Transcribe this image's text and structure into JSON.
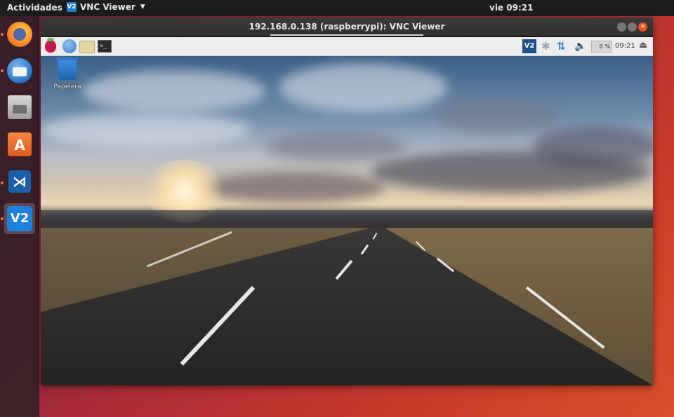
{
  "topbar": {
    "activities": "Actividades",
    "app_name": "VNC Viewer",
    "app_icon_text": "V2",
    "clock": "vie 09:21"
  },
  "dock": {
    "items": [
      {
        "name": "Firefox",
        "icon": "firefox-icon"
      },
      {
        "name": "Thunderbird",
        "icon": "thunderbird-icon"
      },
      {
        "name": "Archivos",
        "icon": "files-icon"
      },
      {
        "name": "Ubuntu Software",
        "icon": "software-store-icon",
        "glyph": "A"
      },
      {
        "name": "Visual Studio Code",
        "icon": "vscode-icon",
        "glyph": "⋊"
      },
      {
        "name": "VNC Viewer",
        "icon": "vnc-viewer-icon",
        "glyph": "V2"
      }
    ]
  },
  "window": {
    "title": "192.168.0.138 (raspberrypi): VNC Viewer",
    "close_glyph": "×"
  },
  "raspberry_panel": {
    "terminal_glyph": ">_",
    "vnc_tray_text": "V2",
    "bluetooth_glyph": "✱",
    "network_glyph": "⇅",
    "volume_glyph": "🔈",
    "cpu_usage": "0 %",
    "clock": "09:21",
    "eject_glyph": "⏏"
  },
  "desktop": {
    "icons": [
      {
        "label": "Papelera"
      }
    ]
  },
  "colors": {
    "accent": "#e95420",
    "vnc_blue": "#1d82dd"
  }
}
